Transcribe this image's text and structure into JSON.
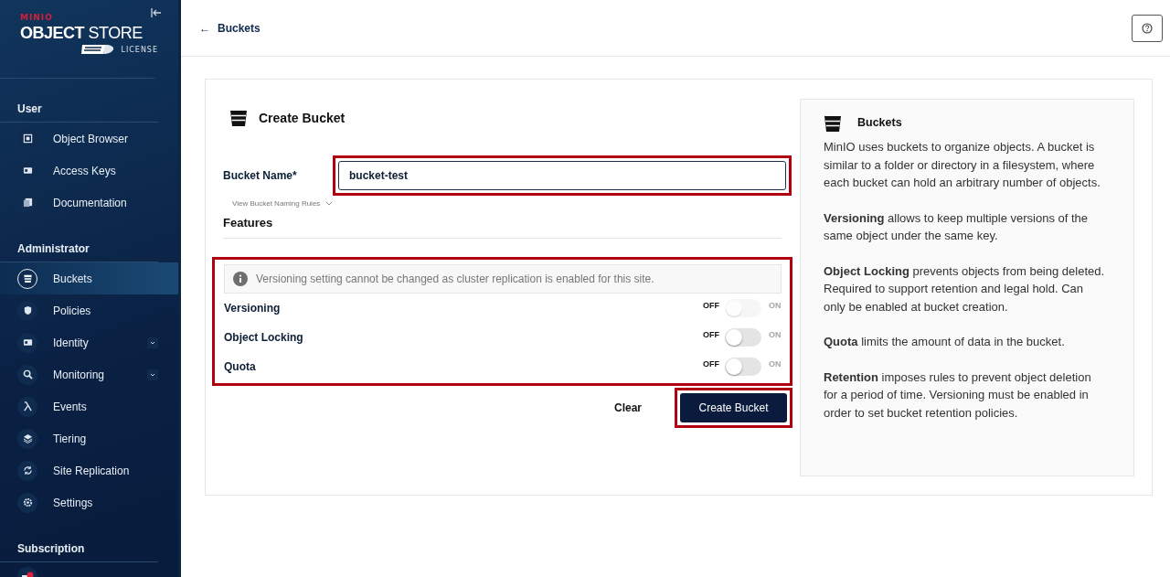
{
  "sidebar": {
    "brand": {
      "maker": "MINIO",
      "product_bold": "OBJECT",
      "product_light": "STORE",
      "license": "LICENSE"
    },
    "sections": [
      {
        "title": "User",
        "items": [
          {
            "label": "Object Browser",
            "selected": false,
            "expandable": false
          },
          {
            "label": "Access Keys",
            "selected": false,
            "expandable": false
          },
          {
            "label": "Documentation",
            "selected": false,
            "expandable": false
          }
        ]
      },
      {
        "title": "Administrator",
        "items": [
          {
            "label": "Buckets",
            "selected": true,
            "expandable": false
          },
          {
            "label": "Policies",
            "selected": false,
            "expandable": false
          },
          {
            "label": "Identity",
            "selected": false,
            "expandable": true
          },
          {
            "label": "Monitoring",
            "selected": false,
            "expandable": true
          },
          {
            "label": "Events",
            "selected": false,
            "expandable": false
          },
          {
            "label": "Tiering",
            "selected": false,
            "expandable": false
          },
          {
            "label": "Site Replication",
            "selected": false,
            "expandable": false
          },
          {
            "label": "Settings",
            "selected": false,
            "expandable": false
          }
        ]
      },
      {
        "title": "Subscription"
      }
    ]
  },
  "header": {
    "back_arrow": "←",
    "back_label": "Buckets"
  },
  "form": {
    "title": "Create Bucket",
    "name_field": {
      "label": "Bucket Name*",
      "value": "bucket-test",
      "highlighted": true
    },
    "naming_rules": "View Bucket Naming Rules",
    "features_title": "Features",
    "features_highlighted": true,
    "notice": "Versioning setting cannot be changed as cluster replication is enabled for this site.",
    "features": [
      {
        "label": "Versioning",
        "off_label": "OFF",
        "on_label": "ON",
        "on": false,
        "disabled": true
      },
      {
        "label": "Object Locking",
        "off_label": "OFF",
        "on_label": "ON",
        "on": false,
        "disabled": false
      },
      {
        "label": "Quota",
        "off_label": "OFF",
        "on_label": "ON",
        "on": false,
        "disabled": false
      }
    ],
    "buttons": {
      "clear": "Clear",
      "create": "Create Bucket",
      "create_highlighted": true
    }
  },
  "info": {
    "title": "Buckets",
    "paragraphs": [
      "MinIO uses buckets to organize objects. A bucket is similar to a folder or directory in a filesystem, where each bucket can hold an arbitrary number of objects.",
      "**Versioning** allows to keep multiple versions of the same object under the same key.",
      "**Object Locking** prevents objects from being deleted. Required to support retention and legal hold. Can only be enabled at bucket creation.",
      "**Quota** limits the amount of data in the bucket.",
      "**Retention** imposes rules to prevent object deletion for a period of time. Versioning must be enabled in order to set bucket retention policies."
    ]
  }
}
